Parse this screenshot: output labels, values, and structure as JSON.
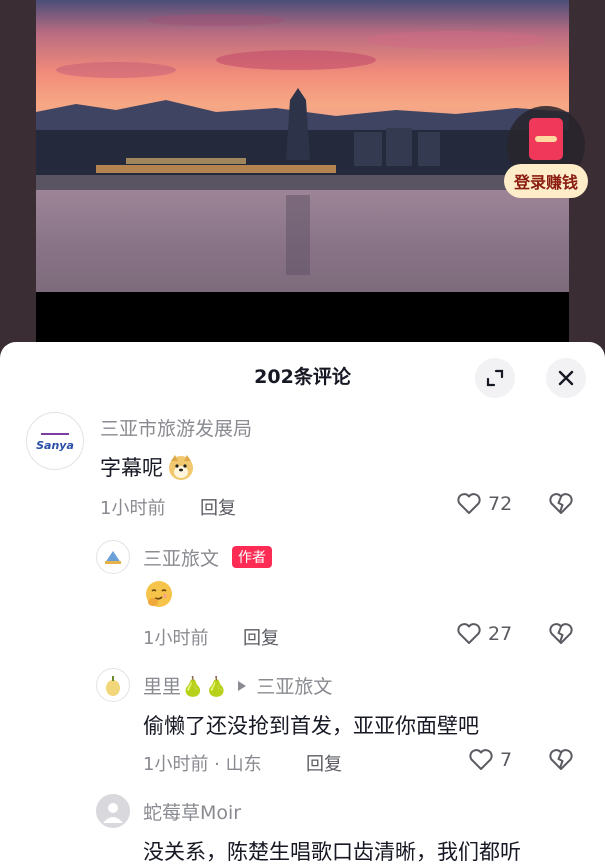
{
  "video": {
    "promo_label": "登录赚钱"
  },
  "sheet": {
    "title": "202条评论"
  },
  "comments": [
    {
      "user": "三亚市旅游发展局",
      "text": "字幕呢",
      "time": "1小时前",
      "reply": "回复",
      "likes": "72"
    },
    {
      "user": "三亚旅文",
      "author_tag": "作者",
      "text": "",
      "time": "1小时前",
      "reply": "回复",
      "likes": "27"
    },
    {
      "user": "里里🍐🍐",
      "reply_to": "三亚旅文",
      "text": "偷懒了还没抢到首发，亚亚你面壁吧",
      "time": "1小时前 · 山东",
      "reply": "回复",
      "likes": "7"
    },
    {
      "user": "蛇莓草Moir",
      "text": "没关系，陈楚生唱歌口齿清晰，我们都听"
    }
  ],
  "colors": {
    "accent": "#fe2c55",
    "text_primary": "#161823",
    "text_secondary": "#8a8b91"
  }
}
